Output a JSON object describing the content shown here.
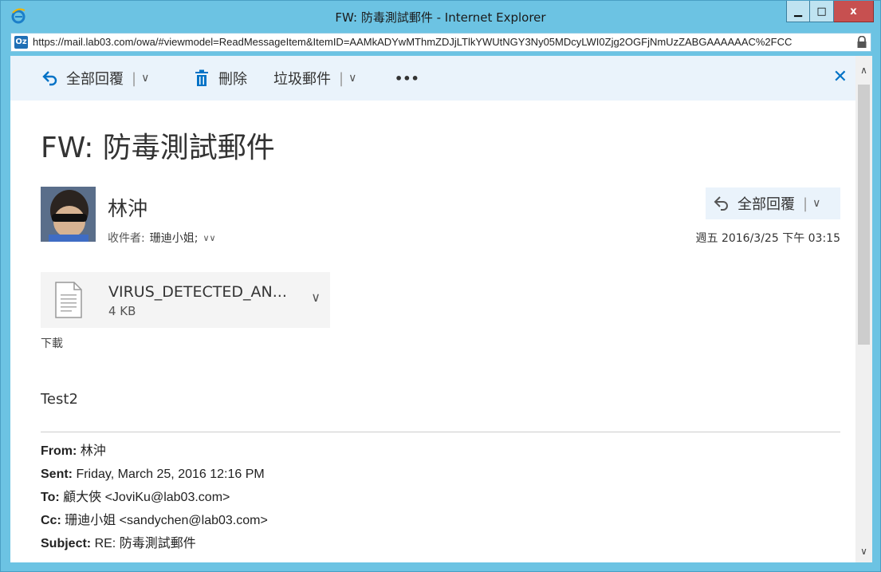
{
  "window": {
    "title": "FW: 防毒測試郵件 - Internet Explorer",
    "url": "https://mail.lab03.com/owa/#viewmodel=ReadMessageItem&ItemID=AAMkADYwMThmZDJjLTlkYWUtNGY3Ny05MDcyLWI0Zjg2OGFjNmUzZABGAAAAAAC%2FCC",
    "favicon": "Oz",
    "buttons": {
      "minimize": "▁",
      "maximize": "□",
      "close": "x"
    }
  },
  "toolbar": {
    "reply_all": "全部回覆",
    "delete": "刪除",
    "junk": "垃圾郵件",
    "more": "•••"
  },
  "message": {
    "subject": "FW: 防毒測試郵件",
    "sender": "林沖",
    "recipients_label": "收件者:",
    "recipients": "珊迪小姐;",
    "reply_all": "全部回覆",
    "date": "週五 2016/3/25 下午 03:15",
    "attachment": {
      "name": "VIRUS_DETECTED_AN...",
      "size": "4 KB"
    },
    "download": "下載",
    "body": "Test2",
    "forwarded": {
      "from_label": "From:",
      "from": "林沖",
      "sent_label": "Sent:",
      "sent": "Friday, March 25, 2016 12:16 PM",
      "to_label": "To:",
      "to": "顧大俠 <JoviKu@lab03.com>",
      "cc_label": "Cc:",
      "cc": "珊迪小姐 <sandychen@lab03.com>",
      "subject_label": "Subject:",
      "subject": "RE: 防毒測試郵件"
    }
  },
  "colors": {
    "accent": "#0072c6",
    "toolbar_bg": "#eaf3fb",
    "frame": "#6cc3e3"
  }
}
